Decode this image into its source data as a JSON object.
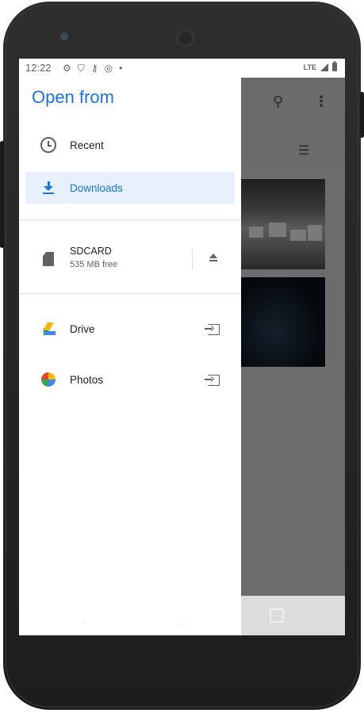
{
  "status_bar": {
    "time": "12:22",
    "left_icons": [
      "gear-icon",
      "shield-icon",
      "key-icon",
      "circle-icon",
      "dot-icon"
    ],
    "network": "LTE"
  },
  "drawer": {
    "title": "Open from",
    "items": [
      {
        "label": "Recent",
        "icon": "clock-icon"
      },
      {
        "label": "Downloads",
        "icon": "download-icon",
        "selected": true
      }
    ],
    "storage": {
      "title": "SDCARD",
      "subtitle": "535 MB free",
      "icon": "sd-card-icon",
      "action_icon": "eject-icon"
    },
    "apps": [
      {
        "label": "Drive",
        "icon": "drive-icon",
        "action_icon": "open-external-icon"
      },
      {
        "label": "Photos",
        "icon": "photos-icon",
        "action_icon": "open-external-icon"
      }
    ]
  },
  "colors": {
    "accent": "#1a73e8",
    "selected_bg": "#e8f0fe",
    "scrim": "#6c6c6c"
  }
}
